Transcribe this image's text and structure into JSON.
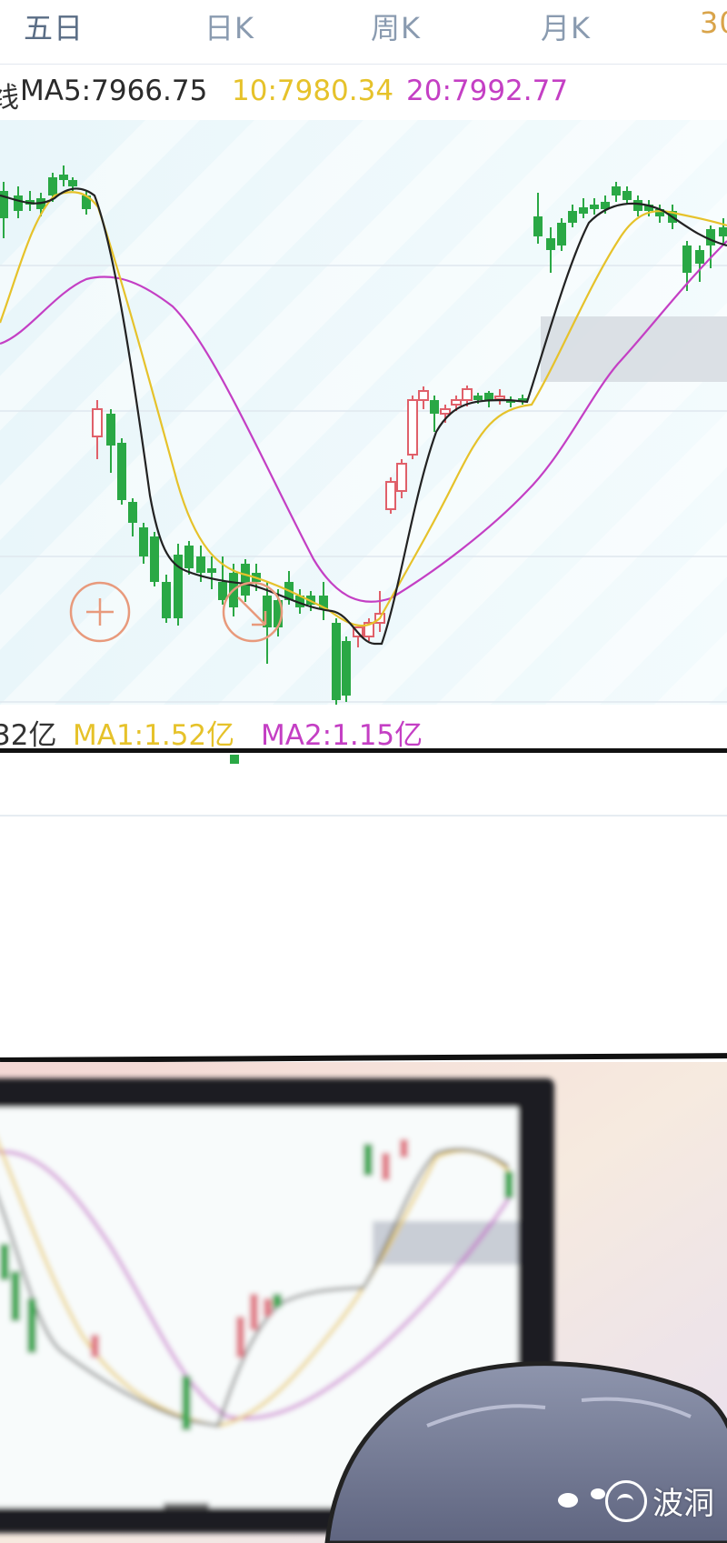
{
  "tabs": [
    "五日",
    "日K",
    "周K",
    "月K",
    "30"
  ],
  "ma_legend": {
    "prefix": "线",
    "ma5": "MA5:7966.75",
    "ma10": "10:7980.34",
    "ma20": "20:7992.77"
  },
  "volume_legend": {
    "value": "32亿",
    "ma1": "MA1:1.52亿",
    "ma2": "MA2:1.15亿"
  },
  "controls": {
    "zoom_icon": "plus-circle-icon",
    "cursor_icon": "arrow-circle-icon"
  },
  "colors": {
    "up": "#e0606a",
    "down": "#2aa845",
    "ma5": "#2b2b2b",
    "ma10": "#e6c22a",
    "ma20": "#c43fc4",
    "accent_tab": "#d9a44a"
  },
  "watermark": {
    "text": "波洞",
    "icon": "wave-logo-icon"
  }
}
